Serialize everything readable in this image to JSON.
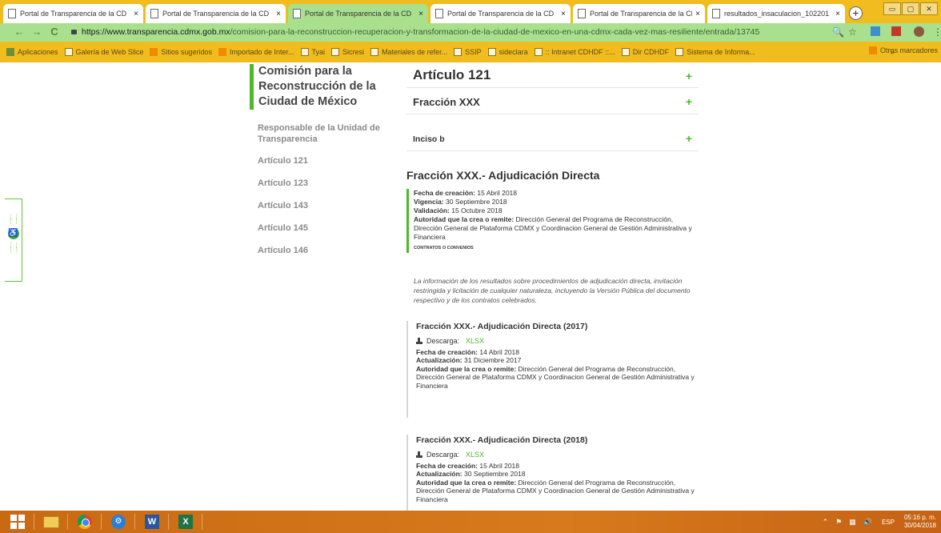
{
  "browser": {
    "tabs": [
      {
        "title": "Portal de Transparencia de la CD",
        "active": false
      },
      {
        "title": "Portal de Transparencia de la CD",
        "active": false
      },
      {
        "title": "Portal de Transparencia de la CD",
        "active": true
      },
      {
        "title": "Portal de Transparencia de la CD",
        "active": false
      },
      {
        "title": "Portal de Transparencia de la CD",
        "active": false
      },
      {
        "title": "resultados_insaculacion_102201",
        "active": false
      }
    ],
    "tab_close": "×",
    "new_tab": "+",
    "window_controls": [
      "▭",
      "▢",
      "✕"
    ],
    "url_base": "https://www.transparencia.cdmx.gob.mx",
    "url_path": "/comision-para-la-reconstruccion-recuperacion-y-transformacion-de-la-ciudad-de-mexico-en-una-cdmx-cada-vez-mas-resiliente/entrada/13745",
    "bookmarks": [
      "Aplicaciones",
      "Galería de Web Slice",
      "Sitios sugeridos",
      "Importado de Inter...",
      "Tyai",
      "Sicresi",
      "Materiales de refer...",
      "SSIP",
      "sideclara",
      ":: Intranet CDHDF ::...",
      "Dir CDHDF",
      "Sistema de Informa..."
    ],
    "bookmarks_more": "»",
    "bookmarks_other": "Otros marcadores",
    "toolbar_icons": {
      "back": "←",
      "forward": "→",
      "reload": "C",
      "zoom": "🔍",
      "star": "☆",
      "menu": "⋮"
    }
  },
  "sidebar": {
    "title": "Comisión para la Reconstrucción de la Ciudad de México",
    "items": [
      "Responsable de la Unidad de Transparencia",
      "Artículo 121",
      "Artículo 123",
      "Artículo 143",
      "Artículo 145",
      "Artículo 146"
    ]
  },
  "accordion": {
    "article": "Artículo 121",
    "fraction": "Fracción XXX",
    "inciso": "Inciso b",
    "expand_symbol": "+"
  },
  "section": {
    "title": "Fracción XXX.- Adjudicación Directa",
    "meta": {
      "created_label": "Fecha de creación:",
      "created": "15 Abril 2018",
      "validity_label": "Vigencia:",
      "validity": "30 Septiembre 2018",
      "validation_label": "Validación:",
      "validation": "15 Octubre 2018",
      "authority_label": "Autoridad que la crea o remite:",
      "authority": "Dirección General del Programa de Reconstrucción, Dirección General de Plataforma CDMX y Coordinacion General de Gestión Administrativa y Financiera",
      "tag": "CONTRATOS O CONVENIOS"
    },
    "description": "La información de los resultados sobre procedimientos de adjudicación directa, invitación restringida y licitación de cualquier naturaleza, incluyendo la Versión Pública del documento respectivo y de los contratos celebrados."
  },
  "documents": [
    {
      "title": "Fracción XXX.- Adjudicación Directa (2017)",
      "download_label": "Descarga:",
      "format": "XLSX",
      "created_label": "Fecha de creación:",
      "created": "14 Abril 2018",
      "updated_label": "Actualización:",
      "updated": "31 Diciembre 2017",
      "authority_label": "Autoridad que la crea o remite:",
      "authority": "Dirección General del Programa de Reconstrucción, Dirección General de Plataforma CDMX y Coordinacion General de Gestión Administrativa y Financiera"
    },
    {
      "title": "Fracción XXX.- Adjudicación Directa (2018)",
      "download_label": "Descarga:",
      "format": "XLSX",
      "created_label": "Fecha de creación:",
      "created": "15 Abril 2018",
      "updated_label": "Actualización:",
      "updated": "30 Septiembre 2018",
      "authority_label": "Autoridad que la crea o remite:",
      "authority": "Dirección General del Programa de Reconstrucción, Dirección General de Plataforma CDMX y Coordinacion General de Gestión Administrativa y Financiera"
    }
  ],
  "taskbar": {
    "language": "ESP",
    "time": "05:16 p. m.",
    "date": "30/04/2018",
    "tray_symbols": [
      "⌃",
      "⚑",
      "▦",
      "🔊"
    ],
    "apps": [
      "windows-start",
      "file-explorer",
      "chrome",
      "app",
      "word",
      "excel"
    ],
    "word_glyph": "W",
    "excel_glyph": "X",
    "app_glyph": "⚙"
  },
  "colors": {
    "accent_green": "#4cb82a",
    "tab_bar": "#f1bc1e",
    "active_tab": "#a9e08d",
    "taskbar": "#d77a1d"
  }
}
